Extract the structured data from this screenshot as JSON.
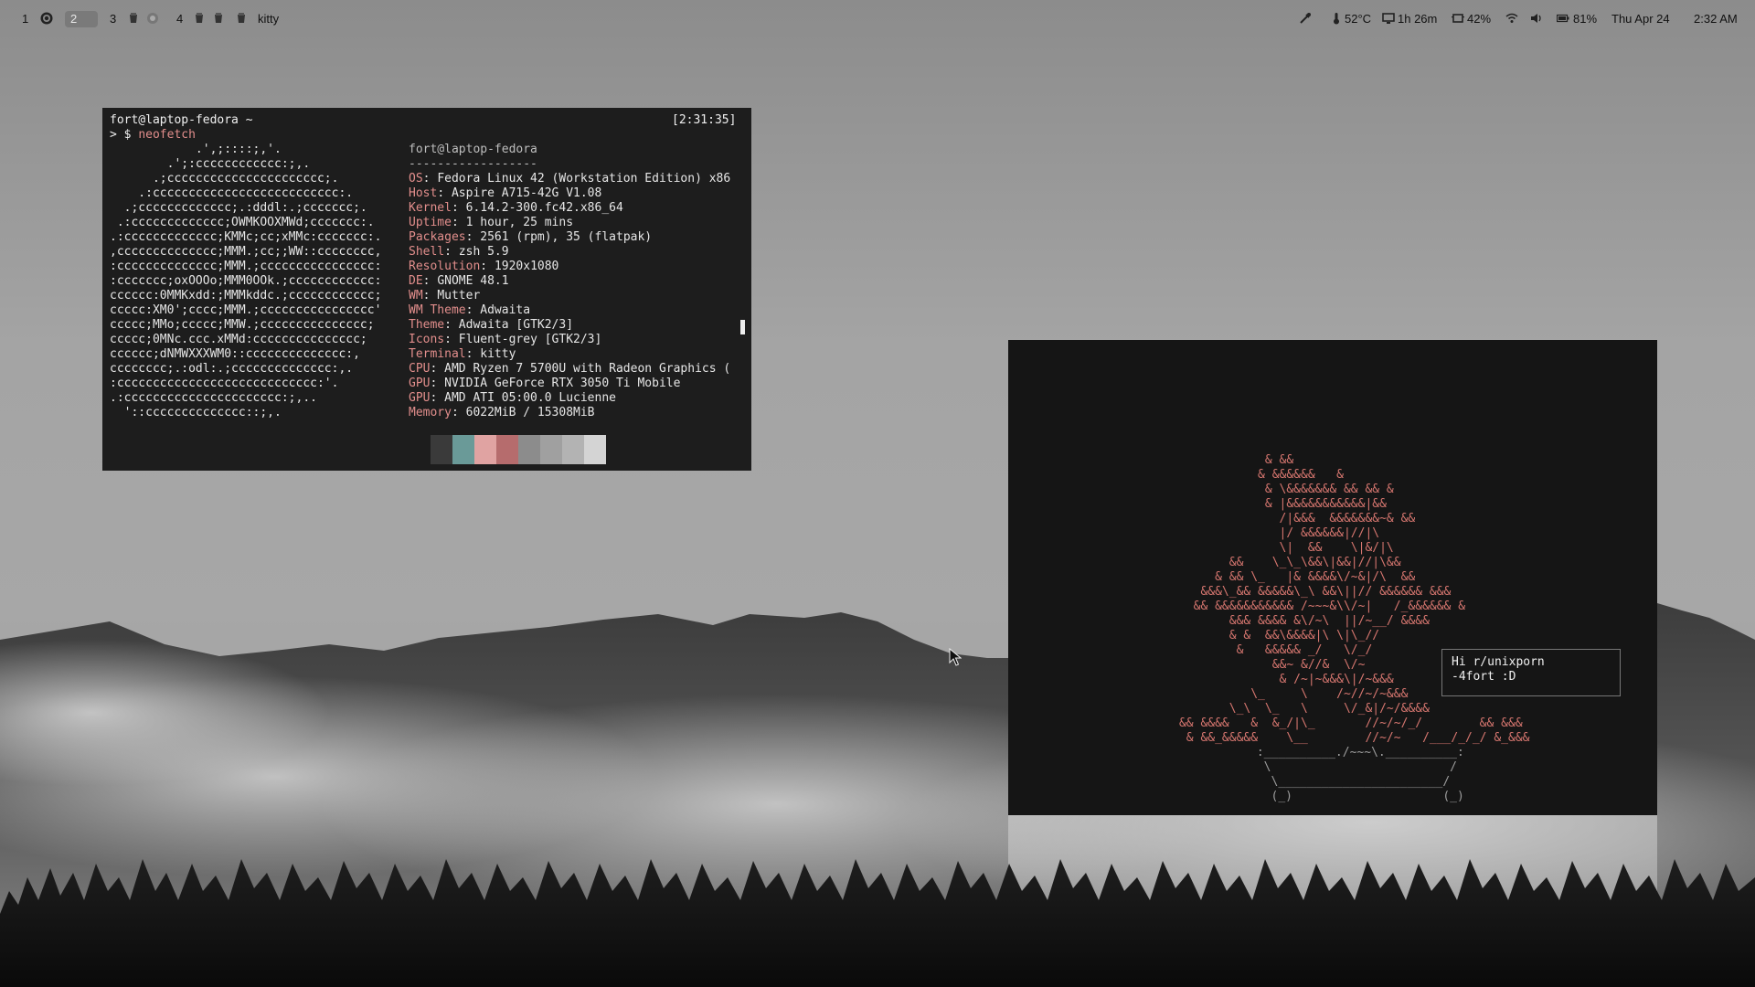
{
  "topbar": {
    "workspaces": [
      {
        "label": "1"
      },
      {
        "label": "2",
        "active": true
      },
      {
        "label": "3"
      },
      {
        "label": "4"
      }
    ],
    "focused_app": "kitty",
    "status": {
      "temperature": "52°C",
      "time_remaining": "1h 26m",
      "cpu": "42%",
      "battery": "81%",
      "date": "Thu Apr 24",
      "clock": "2:32 AM"
    },
    "icons": [
      "gnome-icon",
      "app-icon",
      "color-picker-icon",
      "thermometer-icon",
      "monitor-icon",
      "cpu-icon",
      "wifi-icon",
      "volume-icon",
      "battery-icon"
    ]
  },
  "terminal": {
    "prompt_user": "fort@laptop-fedora ~",
    "timestamp": "[2:31:35]",
    "command_prefix": "> $ ",
    "command": "neofetch",
    "logo": [
      "            .',;::::;,'.",
      "        .';:cccccccccccc:;,.",
      "      .;cccccccccccccccccccccc;.",
      "    .:cccccccccccccccccccccccccc:.",
      "  .;ccccccccccccc;.:dddl:.;ccccccc;.",
      " .:ccccccccccccc;OWMKOOXMWd;ccccccc:.",
      ".:ccccccccccccc;KMMc;cc;xMMc:ccccccc:.",
      ",cccccccccccccc;MMM.;cc;;WW::cccccccc,",
      ":cccccccccccccc;MMM.;cccccccccccccccc:",
      ":ccccccc;oxOOOo;MMM0OOk.;cccccccccccc:",
      "cccccc:0MMKxdd:;MMMkddc.;cccccccccccc;",
      "ccccc:XM0';cccc;MMM.;cccccccccccccccc'",
      "ccccc;MMo;ccccc;MMW.;ccccccccccccccc;",
      "ccccc;0MNc.ccc.xMMd:ccccccccccccccc;",
      "cccccc;dNMWXXXWM0::cccccccccccccc:,",
      "cccccccc;.:odl:.;cccccccccccccc:,.",
      ":cccccccccccccccccccccccccccc:'.",
      ".:cccccccccccccccccccccc:;,..",
      "  '::cccccccccccccc::;,."
    ],
    "info_header": "fort@laptop-fedora",
    "info_rule": "------------------",
    "info": [
      {
        "key": "OS",
        "value": "Fedora Linux 42 (Workstation Edition) x86"
      },
      {
        "key": "Host",
        "value": "Aspire A715-42G V1.08"
      },
      {
        "key": "Kernel",
        "value": "6.14.2-300.fc42.x86_64"
      },
      {
        "key": "Uptime",
        "value": "1 hour, 25 mins"
      },
      {
        "key": "Packages",
        "value": "2561 (rpm), 35 (flatpak)"
      },
      {
        "key": "Shell",
        "value": "zsh 5.9"
      },
      {
        "key": "Resolution",
        "value": "1920x1080"
      },
      {
        "key": "DE",
        "value": "GNOME 48.1"
      },
      {
        "key": "WM",
        "value": "Mutter"
      },
      {
        "key": "WM Theme",
        "value": "Adwaita"
      },
      {
        "key": "Theme",
        "value": "Adwaita [GTK2/3]"
      },
      {
        "key": "Icons",
        "value": "Fluent-grey [GTK2/3]"
      },
      {
        "key": "Terminal",
        "value": "kitty"
      },
      {
        "key": "CPU",
        "value": "AMD Ryzen 7 5700U with Radeon Graphics ("
      },
      {
        "key": "GPU",
        "value": "NVIDIA GeForce RTX 3050 Ti Mobile"
      },
      {
        "key": "GPU",
        "value": "AMD ATI 05:00.0 Lucienne"
      },
      {
        "key": "Memory",
        "value": "6022MiB / 15308MiB"
      }
    ],
    "palette": [
      "#1d1d1d",
      "#3a3a3a",
      "#6a9a98",
      "#e0a3a2",
      "#b66c6d",
      "#8c8c8c",
      "#a0a0a0",
      "#b3b3b3",
      "#d4d4d4"
    ]
  },
  "bonsai": {
    "tree": [
      "                  & &&",
      "                 & &&&&&&   &",
      "                  & \\&&&&&&& && && &",
      "                  & |&&&&&&&&&&&|&&",
      "                    /|&&&  &&&&&&&~& &&",
      "                    |/ &&&&&&|//|\\",
      "                    \\|  &&    \\|&/|\\",
      "             &&    \\_\\_\\&&\\|&&|//|\\&&",
      "           & && \\_   |& &&&&\\/~&|/\\  &&",
      "         &&&\\_&& &&&&&\\_\\ &&\\||// &&&&&& &&&",
      "        && &&&&&&&&&&& /~~~&\\\\/~|   /_&&&&&& &",
      "             &&& &&&& &\\/~\\  ||/~__/ &&&&",
      "             & &  &&\\&&&&|\\ \\|\\_//",
      "              &   &&&&& _/   \\/_/",
      "                   &&~ &//&  \\/~",
      "                    & /~|~&&&\\|/~&&&",
      "                \\_     \\    /~//~/~&&&",
      "             \\_\\  \\_   \\     \\/_&|/~/&&&&",
      "      && &&&&   &  &_/|\\_       //~/~/_/        && &&&",
      "       & &&_&&&&&    \\__        //~/~   /___/_/_/ &_&&&"
    ],
    "pot": [
      "                        :__________./~~~\\.__________:",
      "                         \\                         /",
      "                          \\_______________________/",
      "                          (_)                     (_)"
    ],
    "message": [
      "Hi r/unixporn",
      "-4fort :D"
    ]
  }
}
